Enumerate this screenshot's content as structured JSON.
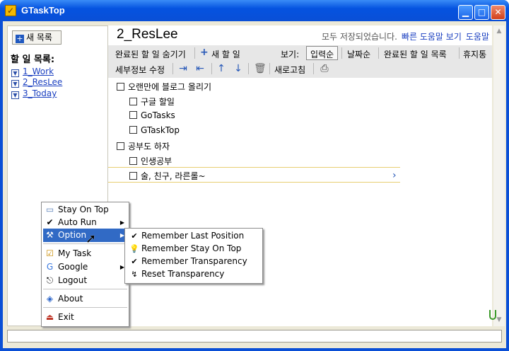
{
  "window": {
    "title": "GTaskTop",
    "icon": "check-icon"
  },
  "sidebar": {
    "new_list_label": "새 목록",
    "heading": "할 일 목록:",
    "lists": [
      {
        "label": "1_Work"
      },
      {
        "label": "2_ResLee"
      },
      {
        "label": "3_Today"
      }
    ]
  },
  "main": {
    "list_title": "2_ResLee",
    "saved_status": "모두 저장되었습니다.",
    "quick_help": "빠른 도움말 보기",
    "help": "도움말",
    "toolbar1": {
      "hide_completed": "완료된 할 일 숨기기",
      "add_task": "새 할 일",
      "view_label": "보기:",
      "view_input_order": "입력순",
      "view_date": "날짜순",
      "view_completed": "완료된 할 일 목록",
      "trash": "휴지통"
    },
    "toolbar2": {
      "edit_details": "세부정보 수정",
      "refresh": "새로고침"
    },
    "tasks": [
      {
        "label": "오랜만에 블로그 올리기",
        "level": 0
      },
      {
        "label": "구글 할일",
        "level": 1
      },
      {
        "label": "GoTasks",
        "level": 1
      },
      {
        "label": "GTaskTop",
        "level": 1
      },
      {
        "label": "공부도 하자",
        "level": 0
      },
      {
        "label": "인생공부",
        "level": 1
      },
      {
        "label": "술, 친구, 라른롤~",
        "level": 1
      }
    ]
  },
  "context_menu": {
    "items": [
      {
        "label": "Stay On Top",
        "icon": "window-icon"
      },
      {
        "label": "Auto Run",
        "icon": "check-icon",
        "submenu": true
      },
      {
        "label": "Option",
        "icon": "tools-icon",
        "submenu": true,
        "active": true
      },
      {
        "label": "My Task",
        "icon": "task-icon"
      },
      {
        "label": "Google",
        "icon": "google-icon",
        "submenu": true
      },
      {
        "label": "Logout",
        "icon": "logout-icon"
      },
      {
        "label": "About",
        "icon": "about-icon"
      },
      {
        "label": "Exit",
        "icon": "exit-icon"
      }
    ]
  },
  "option_submenu": {
    "items": [
      {
        "label": "Remember Last Position",
        "icon": "check-icon"
      },
      {
        "label": "Remember Stay On Top",
        "icon": "bulb-icon"
      },
      {
        "label": "Remember Transparency",
        "icon": "check-icon"
      },
      {
        "label": "Reset Transparency",
        "icon": "reset-icon"
      }
    ]
  },
  "colors": {
    "titlebar": "#0a4fd6",
    "menu_highlight": "#316ac5",
    "link": "#1a3fc0"
  }
}
